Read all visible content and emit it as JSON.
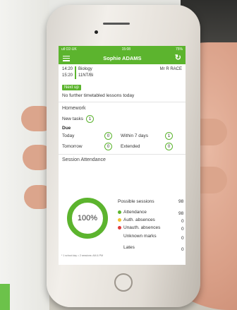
{
  "status_bar": {
    "carrier": "ull O2-UK",
    "time": "15:08",
    "battery": "75%"
  },
  "app_bar": {
    "title": "Sophie ADAMS",
    "menu_icon": "menu-icon",
    "refresh_icon": "refresh-icon"
  },
  "lesson": {
    "start": "14:20",
    "end": "15:20",
    "subject": "Biology",
    "code": "11NT/Bi",
    "teacher": "Mr R RACE"
  },
  "next_up": {
    "label": "Next up",
    "message": "No further timetabled lessons today"
  },
  "homework": {
    "title": "Homework",
    "new_tasks_label": "New tasks",
    "new_tasks": "1",
    "due_label": "Due",
    "today_label": "Today",
    "today": "0",
    "within7_label": "Within 7 days",
    "within7": "1",
    "tomorrow_label": "Tomorrow",
    "tomorrow": "0",
    "extended_label": "Extended",
    "extended": "0"
  },
  "attendance": {
    "title": "Session Attendance",
    "percent_label": "100%",
    "possible_label": "Possible sessions",
    "possible": "98",
    "attendance_label": "Attendance",
    "attendance": "98",
    "auth_label": "Auth. absences",
    "auth": "0",
    "unauth_label": "Unauth. absences",
    "unauth": "0",
    "unknown_label": "Unknown marks",
    "unknown": "0",
    "lates_label": "Lates",
    "lates": "0",
    "footnote": "* 1 school day = 2 sessions: AM & PM",
    "colors": {
      "attendance": "#5cb42e",
      "auth": "#f2c230",
      "unauth": "#e03a3a"
    }
  },
  "colors": {
    "accent": "#5cb42e"
  }
}
